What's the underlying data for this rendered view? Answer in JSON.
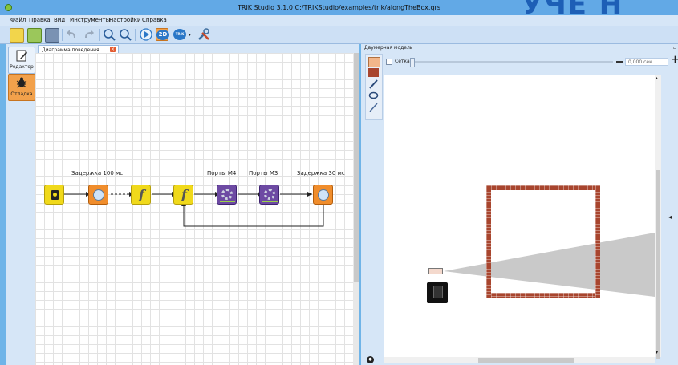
{
  "window": {
    "title": "TRIK Studio 3.1.0 C:/TRIKStudio/examples/trik/alongTheBox.qrs",
    "deco_text": "УЧЕ Н"
  },
  "menu": [
    "Файл",
    "Правка",
    "Вид",
    "Инструменты",
    "Настройки",
    "Справка"
  ],
  "toolbar": {
    "icons": [
      "new-icon",
      "open-icon",
      "save-icon",
      "undo-icon",
      "redo-icon",
      "zoom-in-icon",
      "zoom-out-icon",
      "run-icon",
      "2d-model-icon",
      "trik-icon",
      "settings-icon"
    ],
    "model_2d_label": "2D",
    "trik_label": "TRIK"
  },
  "modes": [
    {
      "label": "Редактор",
      "icon": "edit-icon"
    },
    {
      "label": "Отладка",
      "icon": "debug-bug-icon"
    }
  ],
  "diagram": {
    "tab_label": "Диаграмма поведения робота",
    "blocks": [
      {
        "name": "initial-node",
        "label": ""
      },
      {
        "name": "timer-block-1",
        "label": "Задержка 100 мс"
      },
      {
        "name": "function-block-1",
        "label": ""
      },
      {
        "name": "function-block-2",
        "label": ""
      },
      {
        "name": "motors-block-1",
        "label": "Порты M4"
      },
      {
        "name": "motors-block-2",
        "label": "Порты M3"
      },
      {
        "name": "timer-block-2",
        "label": "Задержка 30 мс"
      }
    ]
  },
  "model_panel": {
    "title": "Двумерная модель",
    "grid_label": "Сетка",
    "time_value": "0,000 сек.",
    "plus_label": "+"
  },
  "colors": {
    "timer": "#f08d2c",
    "function": "#f0d91b",
    "motor": "#6d4aa3",
    "initial": "#f0d91b",
    "wall": "#a8452e"
  }
}
